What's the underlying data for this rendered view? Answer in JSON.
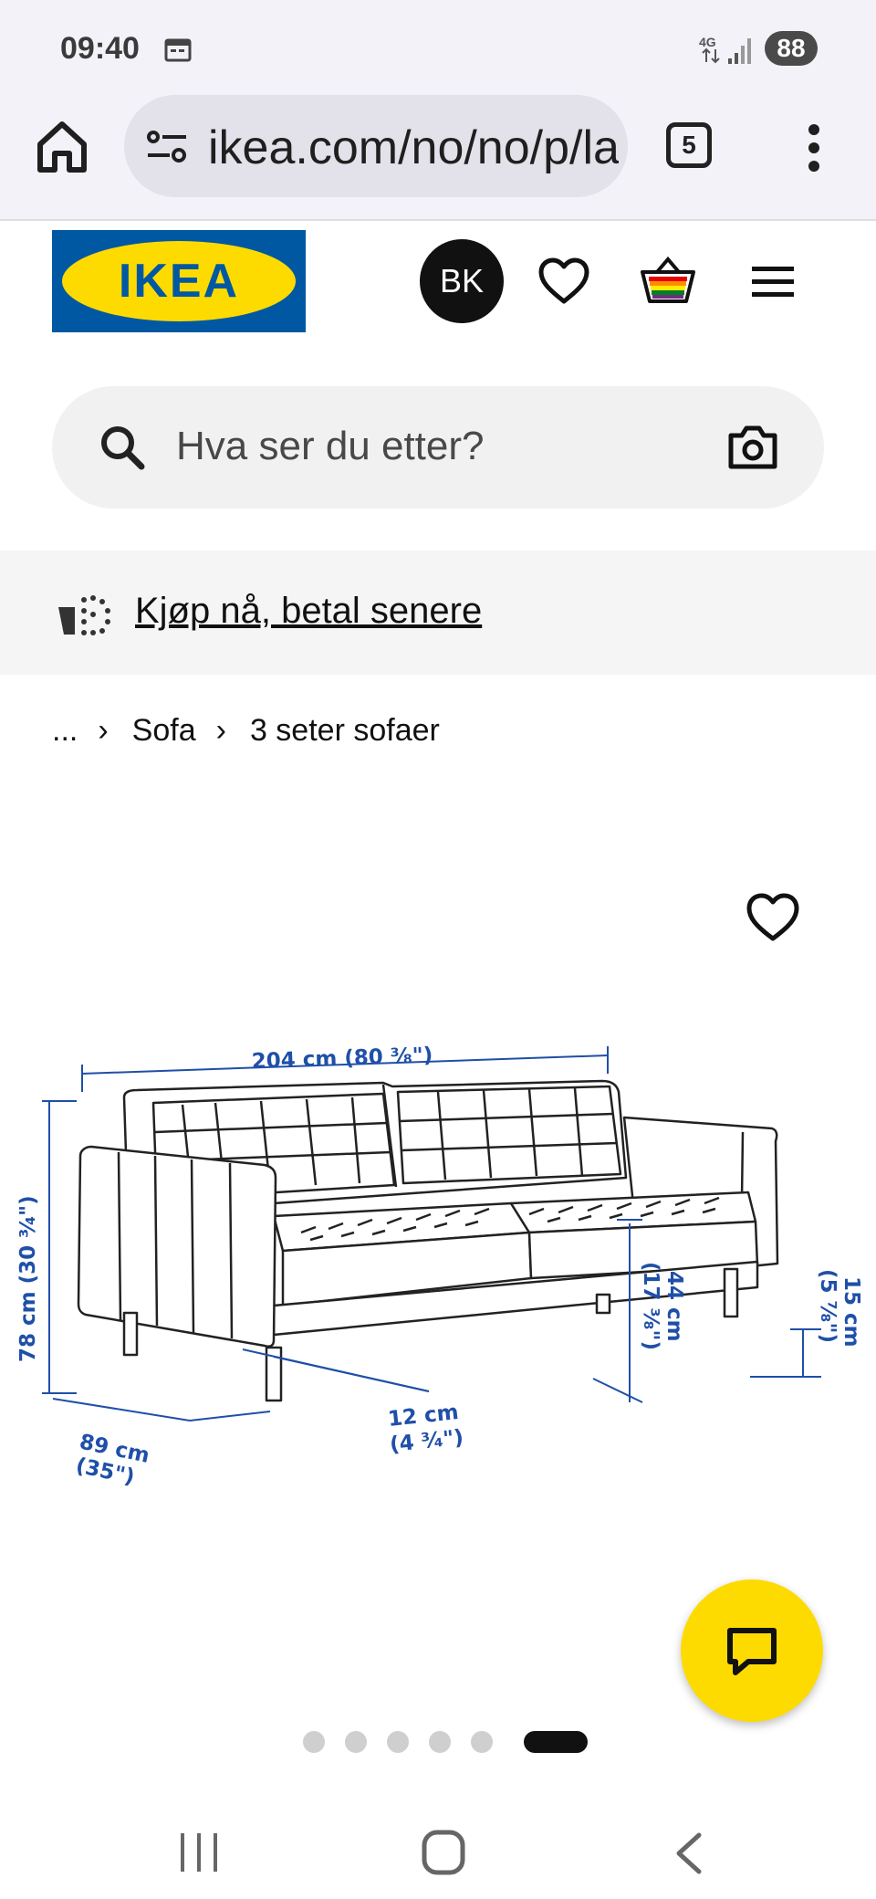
{
  "status": {
    "time": "09:40",
    "network": "4G",
    "battery": "88"
  },
  "browser": {
    "url": "ikea.com/no/no/p/la",
    "tab_count": "5"
  },
  "header": {
    "logo_text": "IKEA",
    "avatar_initials": "BK"
  },
  "search": {
    "placeholder": "Hva ser du etter?"
  },
  "promo": {
    "link_text": "Kjøp nå, betal senere"
  },
  "breadcrumb": {
    "ellipsis": "...",
    "items": [
      "Sofa",
      "3 seter sofaer"
    ]
  },
  "product_image": {
    "dimensions": {
      "width": "204 cm (80 ³⁄₈\")",
      "height_1": "78 cm (30 ³⁄₄\")",
      "depth_1": "89 cm",
      "depth_2": "(35\")",
      "leg_1": "12 cm",
      "leg_2": "(4 ³⁄₄\")",
      "seat_1": "44 cm",
      "seat_2": "(17 ³⁄₈\")",
      "clear_1": "15 cm",
      "clear_2": "(5 ⁷⁄₈\")"
    }
  },
  "carousel": {
    "total": 6,
    "active_index": 5
  },
  "colors": {
    "ikea_blue": "#0058a3",
    "ikea_yellow": "#fedb00",
    "dimension_blue": "#1f4fa8"
  }
}
